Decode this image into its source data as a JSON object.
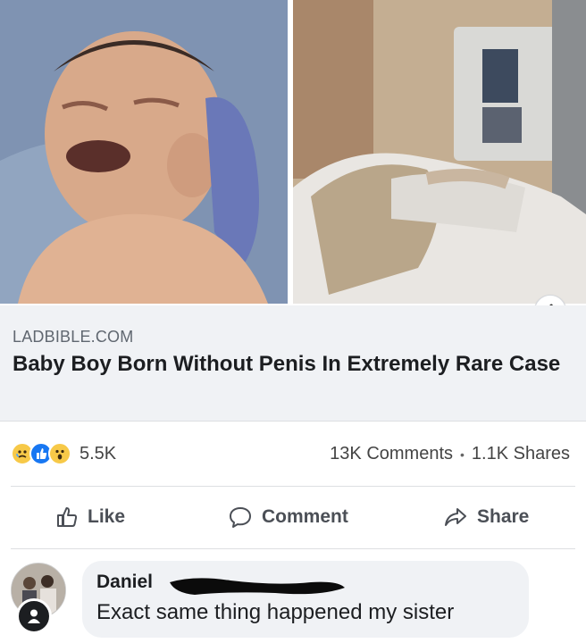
{
  "link": {
    "domain": "LADBIBLE.COM",
    "title": "Baby Boy Born Without Penis In Extremely Rare Case"
  },
  "stats": {
    "reaction_icons": [
      "sad-reaction-icon",
      "like-reaction-icon",
      "wow-reaction-icon"
    ],
    "reaction_count": "5.5K",
    "comments": "13K Comments",
    "separator": "•",
    "shares": "1.1K Shares"
  },
  "actions": {
    "like": "Like",
    "comment": "Comment",
    "share": "Share"
  },
  "comment": {
    "author": "Daniel",
    "text": "Exact same thing happened my sister"
  },
  "colors": {
    "accent": "#1877f2",
    "panel": "#f0f2f5",
    "text": "#1c1e21",
    "muted": "#606770"
  }
}
